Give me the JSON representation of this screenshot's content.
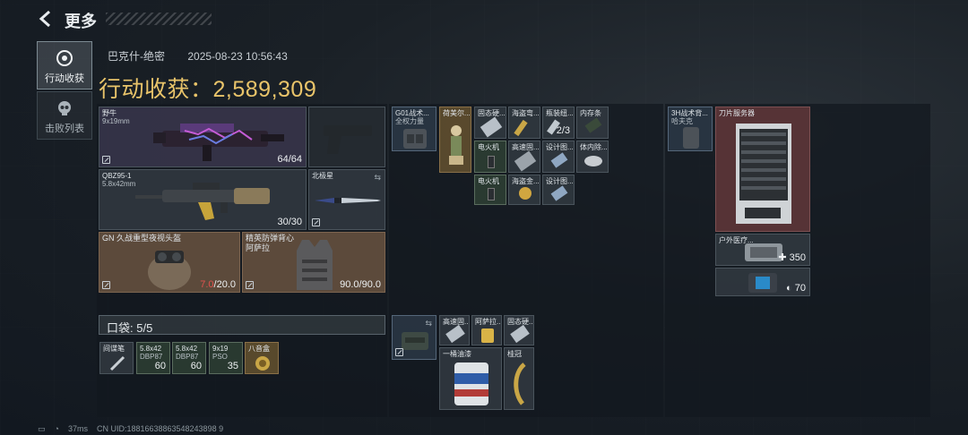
{
  "nav": {
    "title": "更多"
  },
  "tabs": [
    {
      "label": "行动收获",
      "active": true
    },
    {
      "label": "击败列表",
      "active": false
    }
  ],
  "header": {
    "player": "巴克什-绝密",
    "datetime": "2025-08-23 10:56:43",
    "loot_label": "行动收获：",
    "loot_value": "2,589,309"
  },
  "weapons": [
    {
      "name": "野牛",
      "ammo": "9x19mm",
      "count": "64/64"
    },
    {
      "name": "QBZ95-1",
      "ammo": "5.8x42mm",
      "count": "30/30"
    },
    {
      "name": "北极星"
    }
  ],
  "gear": {
    "helmet": {
      "name": "GN 久战重型夜视头盔",
      "durability_current": "7.0",
      "durability_max": "/20.0"
    },
    "armor": {
      "name": "精英防弹背心",
      "sub": "阿萨拉",
      "durability": "90.0/90.0"
    }
  },
  "pockets": {
    "label": "口袋: 5/5",
    "items": [
      {
        "name": "间谍笔"
      },
      {
        "name": "5.8x42",
        "sub": "DBP87",
        "count": "60"
      },
      {
        "name": "5.8x42",
        "sub": "DBP87",
        "count": "60"
      },
      {
        "name": "9x19",
        "sub": "PSO",
        "count": "35"
      },
      {
        "name": "八音盒"
      }
    ]
  },
  "rig": {
    "name": "G01战术...",
    "sub": "全权力量",
    "items": [
      {
        "name": "荷美尔..."
      },
      {
        "name": "固态硬..."
      },
      {
        "name": "海盗弯..."
      },
      {
        "name": "瓶装纽...",
        "count": "2/3"
      },
      {
        "name": "电火机"
      },
      {
        "name": "高速固..."
      },
      {
        "name": "设计图..."
      },
      {
        "name": "电火机"
      },
      {
        "name": "海盗金..."
      },
      {
        "name": "设计图..."
      },
      {
        "name": "内存条"
      },
      {
        "name": "体内除..."
      }
    ]
  },
  "backpack": {
    "name": "",
    "items": [
      {
        "name": "高速固..."
      },
      {
        "name": "阿萨拉..."
      },
      {
        "name": "固态硬..."
      },
      {
        "name": "一桶油漆"
      },
      {
        "name": "桂冠"
      }
    ]
  },
  "case": {
    "name": "3H战术背...",
    "sub": "哈夫克",
    "items": [
      {
        "name": "刀片服务器"
      },
      {
        "name": "户外医疗...",
        "count": "350"
      },
      {
        "name": "",
        "count": "70"
      }
    ]
  },
  "footer": {
    "battery": "",
    "ping": "37ms",
    "uid": "CN UID:18816638863548243898 9"
  },
  "colors": {
    "gold": "#e9c46a",
    "red": "#e0524e"
  }
}
